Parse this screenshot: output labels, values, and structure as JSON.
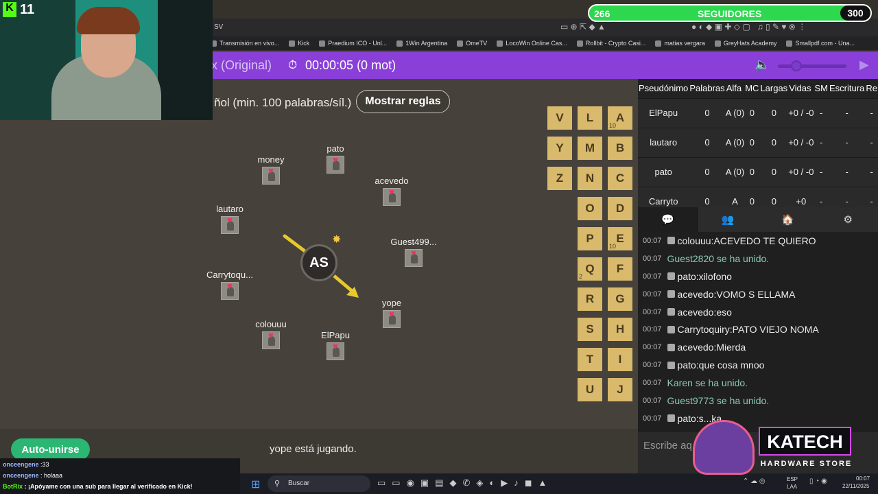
{
  "overlay": {
    "kick_followers_count": "11",
    "followers_left": "266",
    "followers_label": "SEGUIDORES",
    "followers_right": "300"
  },
  "browser": {
    "tab_fragment": "SV",
    "bookmarks": [
      "Transmisión en vivo...",
      "Kick",
      "Praedium ICO - Unl...",
      "1Win Argentina",
      "OmeTV",
      "LocoWin Online Cas...",
      "Rollbit - Crypto Casi...",
      "matias vergara",
      "GreyHats Academy",
      "Smallpdf.com - Una..."
    ]
  },
  "game_header": {
    "title_fragment": "x (Original)",
    "timer": "00:00:05 (0 mot)"
  },
  "rules": {
    "text": "ñol (min. 100 palabras/síl.)",
    "button": "Mostrar reglas"
  },
  "players": [
    "money",
    "pato",
    "acevedo",
    "lautaro",
    "Guest499...",
    "Carrytoqu...",
    "yope",
    "colouuu",
    "ElPapu"
  ],
  "bomb": {
    "syllable": "AS"
  },
  "letters": [
    {
      "l": "V"
    },
    {
      "l": "L"
    },
    {
      "l": "A",
      "n": "10"
    },
    {
      "l": "Y"
    },
    {
      "l": "M"
    },
    {
      "l": "B"
    },
    {
      "l": "Z"
    },
    {
      "l": "N"
    },
    {
      "l": "C"
    },
    {
      "l": "O"
    },
    {
      "l": "D"
    },
    {
      "l": "P"
    },
    {
      "l": "E",
      "n": "10"
    },
    {
      "l": "Q",
      "n": "2"
    },
    {
      "l": "F"
    },
    {
      "l": "R"
    },
    {
      "l": "G"
    },
    {
      "l": "S"
    },
    {
      "l": "H"
    },
    {
      "l": "T"
    },
    {
      "l": "I"
    },
    {
      "l": "U"
    },
    {
      "l": "J"
    }
  ],
  "status": "yope está jugando.",
  "auto_join": "Auto-unirse",
  "scoreboard": {
    "headers": [
      "Pseudónimo",
      "Palabras",
      "Alfa",
      "MC",
      "Largas",
      "Vidas",
      "SM",
      "Escritura",
      "Re"
    ],
    "rows": [
      [
        "ElPapu",
        "0",
        "A (0)",
        "0",
        "0",
        "+0 / -0",
        "-",
        "-",
        "-"
      ],
      [
        "lautaro",
        "0",
        "A (0)",
        "0",
        "0",
        "+0 / -0",
        "-",
        "-",
        "-"
      ],
      [
        "pato",
        "0",
        "A (0)",
        "0",
        "0",
        "+0 / -0",
        "-",
        "-",
        "-"
      ],
      [
        "Carryto",
        "0",
        "A",
        "0",
        "0",
        "+0",
        "-",
        "-",
        "-"
      ]
    ]
  },
  "chat": [
    {
      "time": "00:07",
      "user": "colouuu",
      "msg": "ACEVEDO TE QUIERO"
    },
    {
      "time": "00:07",
      "join": "Guest2820 se ha unido."
    },
    {
      "time": "00:07",
      "user": "pato",
      "msg": "xilofono"
    },
    {
      "time": "00:07",
      "user": "acevedo",
      "msg": "VOMO S ELLAMA"
    },
    {
      "time": "00:07",
      "user": "acevedo",
      "msg": "eso"
    },
    {
      "time": "00:07",
      "user": "Carrytoquiry",
      "msg": "PATO VIEJO NOMA"
    },
    {
      "time": "00:07",
      "user": "acevedo",
      "msg": "Mierda"
    },
    {
      "time": "00:07",
      "user": "pato",
      "msg": "que cosa mnoo"
    },
    {
      "time": "00:07",
      "join": "Karen se ha unido."
    },
    {
      "time": "00:07",
      "join": "Guest9773 se ha unido."
    },
    {
      "time": "00:07",
      "user": "pato",
      "msg": "s...ka"
    }
  ],
  "chat_placeholder": "Escribe aq...",
  "kick_chat": [
    {
      "user": "onceengene",
      "msg": ":33"
    },
    {
      "user": "onceengene",
      "msg": ": holaaa"
    },
    {
      "user": "BotRix",
      "msg": ": ¡Apóyame con una sub para llegar al verificado en Kick!"
    }
  ],
  "taskbar": {
    "search": "Buscar",
    "lang": "ESP",
    "lang2": "LAA",
    "time": "00:07",
    "date": "22/11/2025"
  },
  "sponsor": {
    "name": "KATECH",
    "tagline": "HARDWARE STORE"
  }
}
